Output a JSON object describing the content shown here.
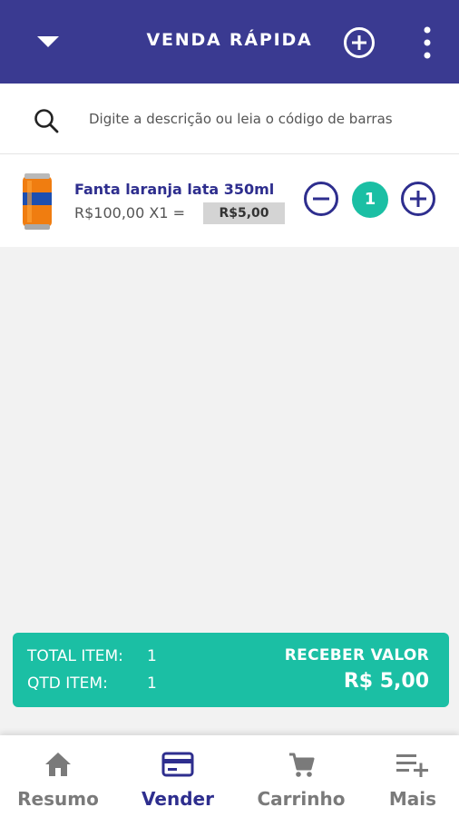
{
  "header": {
    "title": "VENDA RÁPIDA",
    "background": "#3a3a91"
  },
  "search": {
    "placeholder": "Digite a descrição ou leia o código de barras",
    "value": ""
  },
  "cart_item": {
    "name": "Fanta laranja lata 350ml",
    "price_line": "R$100,00 X1 =",
    "total": "R$5,00",
    "quantity": "1",
    "image_icon": "orange-soda-can"
  },
  "summary": {
    "total_item_label": "TOTAL ITEM:",
    "total_item_value": "1",
    "qtd_item_label": "QTD ITEM:",
    "qtd_item_value": "1",
    "action_label": "RECEBER VALOR",
    "amount": "R$ 5,00",
    "background": "#1bbfa4"
  },
  "bottom_nav": {
    "items": [
      {
        "label": "Resumo",
        "icon": "home-icon",
        "active": false
      },
      {
        "label": "Vender",
        "icon": "card-icon",
        "active": true
      },
      {
        "label": "Carrinho",
        "icon": "cart-icon",
        "active": false
      },
      {
        "label": "Mais",
        "icon": "playlist-add-icon",
        "active": false
      }
    ]
  },
  "colors": {
    "primary": "#2e2e8e",
    "accent": "#1bbfa4"
  }
}
